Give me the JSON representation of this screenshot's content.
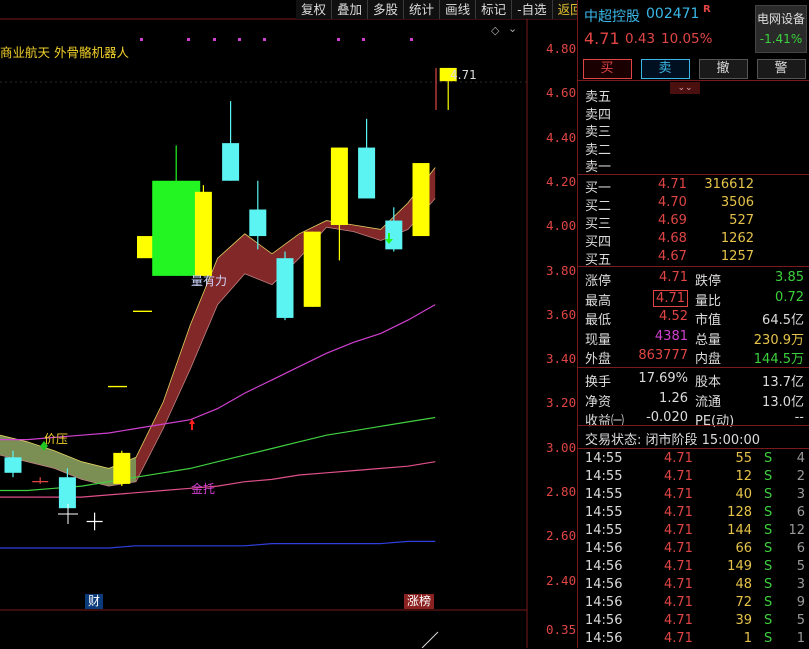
{
  "toolbar": [
    "复权",
    "叠加",
    "多股",
    "统计",
    "画线",
    "标记",
    "-自选",
    "返回"
  ],
  "indicator_title": "商业航天 外骨骼机器人",
  "price_axis": [
    "4.80",
    "4.60",
    "4.40",
    "4.20",
    "4.00",
    "3.80",
    "3.60",
    "3.40",
    "3.20",
    "3.00",
    "2.80",
    "2.60",
    "2.40"
  ],
  "sub_axis": "0.35",
  "last_price_marker": "4.71",
  "annotations": {
    "jia_ya": "价压",
    "jin_tuo": "金托",
    "liang_you_li": "量有力"
  },
  "tags": {
    "cai": "财",
    "zhang_bang": "涨榜"
  },
  "chart_data": {
    "type": "candlestick",
    "ylim": [
      2.3,
      4.88
    ],
    "candles": [
      {
        "o": 2.95,
        "h": 2.98,
        "l": 2.86,
        "c": 2.88,
        "color": "cyan"
      },
      {
        "o": 2.85,
        "h": 2.86,
        "l": 2.83,
        "c": 2.84,
        "color": "red-cross"
      },
      {
        "o": 2.86,
        "h": 2.9,
        "l": 2.72,
        "c": 2.72,
        "color": "cyan"
      },
      {
        "o": 2.68,
        "h": 2.7,
        "l": 2.62,
        "c": 2.66,
        "color": "white-cross"
      },
      {
        "o": 2.83,
        "h": 2.98,
        "l": 2.82,
        "c": 2.97,
        "color": "yellow"
      },
      {
        "o": 3.9,
        "h": 3.95,
        "l": 3.85,
        "c": 3.9,
        "color": "yellow-dash"
      },
      {
        "o": 4.2,
        "h": 4.36,
        "l": 3.77,
        "c": 3.77,
        "color": "green"
      },
      {
        "o": 3.77,
        "h": 4.18,
        "l": 3.77,
        "c": 4.15,
        "color": "yellow"
      },
      {
        "o": 4.2,
        "h": 4.56,
        "l": 4.2,
        "c": 4.37,
        "color": "cyan"
      },
      {
        "o": 4.07,
        "h": 4.2,
        "l": 3.89,
        "c": 3.95,
        "color": "cyan"
      },
      {
        "o": 3.85,
        "h": 3.88,
        "l": 3.57,
        "c": 3.58,
        "color": "cyan"
      },
      {
        "o": 3.63,
        "h": 3.97,
        "l": 3.63,
        "c": 3.97,
        "color": "yellow"
      },
      {
        "o": 4.0,
        "h": 4.35,
        "l": 3.84,
        "c": 4.35,
        "color": "yellow"
      },
      {
        "o": 4.35,
        "h": 4.48,
        "l": 4.12,
        "c": 4.12,
        "color": "cyan"
      },
      {
        "o": 4.02,
        "h": 4.08,
        "l": 3.88,
        "c": 3.89,
        "color": "cyan"
      },
      {
        "o": 3.95,
        "h": 4.28,
        "l": 3.95,
        "c": 4.28,
        "color": "yellow"
      },
      {
        "o": 4.65,
        "h": 4.71,
        "l": 4.52,
        "c": 4.71,
        "color": "yellow"
      }
    ],
    "ma_magenta": [
      3.03,
      3.03,
      3.04,
      3.05,
      3.06,
      3.08,
      3.1,
      3.12,
      3.17,
      3.24,
      3.3,
      3.36,
      3.42,
      3.47,
      3.51,
      3.57,
      3.64
    ],
    "ma_green": [
      2.8,
      2.8,
      2.81,
      2.82,
      2.84,
      2.86,
      2.88,
      2.9,
      2.93,
      2.96,
      2.99,
      3.02,
      3.05,
      3.07,
      3.09,
      3.11,
      3.13
    ],
    "ma_pink": [
      2.77,
      2.77,
      2.77,
      2.77,
      2.78,
      2.79,
      2.8,
      2.81,
      2.82,
      2.84,
      2.85,
      2.87,
      2.88,
      2.89,
      2.9,
      2.91,
      2.93
    ],
    "ma_blue": [
      2.54,
      2.54,
      2.54,
      2.54,
      2.54,
      2.55,
      2.55,
      2.55,
      2.55,
      2.55,
      2.56,
      2.56,
      2.56,
      2.56,
      2.56,
      2.57,
      2.57
    ],
    "band_upper": [
      3.05,
      3.02,
      2.98,
      2.93,
      2.9,
      2.95,
      3.2,
      3.55,
      3.85,
      3.96,
      3.87,
      3.96,
      4.02,
      4.0,
      3.98,
      4.1,
      4.26
    ],
    "band_lower": [
      2.96,
      2.93,
      2.9,
      2.85,
      2.82,
      2.84,
      3.08,
      3.35,
      3.64,
      3.78,
      3.73,
      3.85,
      3.99,
      3.97,
      3.93,
      3.98,
      4.12
    ]
  },
  "quote": {
    "name": "中超控股",
    "code": "002471",
    "badge": "R",
    "price": "4.71",
    "change": "0.43",
    "change_pct": "10.05%",
    "sector_name": "电网设备",
    "sector_change": "-1.41%"
  },
  "trade_buttons": [
    "买",
    "卖",
    "撤",
    "警"
  ],
  "asks": [
    "卖五",
    "卖四",
    "卖三",
    "卖二",
    "卖一"
  ],
  "bids": [
    {
      "label": "买一",
      "price": "4.71",
      "vol": "316612"
    },
    {
      "label": "买二",
      "price": "4.70",
      "vol": "3506"
    },
    {
      "label": "买三",
      "price": "4.69",
      "vol": "527"
    },
    {
      "label": "买四",
      "price": "4.68",
      "vol": "1262"
    },
    {
      "label": "买五",
      "price": "4.67",
      "vol": "1257"
    }
  ],
  "stats": [
    {
      "l1": "涨停",
      "v1": "4.71",
      "c1": "#e04545",
      "l2": "跌停",
      "v2": "3.85",
      "c2": "#3cd13c"
    },
    {
      "l1": "最高",
      "v1": "4.71",
      "c1": "#e04545",
      "boxed": true,
      "l2": "量比",
      "v2": "0.72",
      "c2": "#3cd13c"
    },
    {
      "l1": "最低",
      "v1": "4.52",
      "c1": "#e04545",
      "l2": "市值",
      "v2": "64.5亿",
      "c2": "#dcdcdc"
    },
    {
      "l1": "现量",
      "v1": "4381",
      "c1": "#d040d0",
      "l2": "总量",
      "v2": "230.9万",
      "c2": "#e6c34a"
    },
    {
      "l1": "外盘",
      "v1": "863777",
      "c1": "#e04545",
      "l2": "内盘",
      "v2": "144.5万",
      "c2": "#3cd13c"
    }
  ],
  "stats2": [
    {
      "l1": "换手",
      "v1": "17.69%",
      "c1": "#dcdcdc",
      "l2": "股本",
      "v2": "13.7亿",
      "c2": "#dcdcdc"
    },
    {
      "l1": "净资",
      "v1": "1.26",
      "c1": "#dcdcdc",
      "l2": "流通",
      "v2": "13.0亿",
      "c2": "#dcdcdc"
    },
    {
      "l1": "收益㈠",
      "v1": "-0.020",
      "c1": "#dcdcdc",
      "l2": "PE(动)",
      "v2": "--",
      "c2": "#dcdcdc"
    }
  ],
  "status": "交易状态: 闭市阶段 15:00:00",
  "ticks": [
    {
      "t": "14:55",
      "p": "4.71",
      "v": "55",
      "s": "S",
      "n": "4"
    },
    {
      "t": "14:55",
      "p": "4.71",
      "v": "12",
      "s": "S",
      "n": "2"
    },
    {
      "t": "14:55",
      "p": "4.71",
      "v": "40",
      "s": "S",
      "n": "3"
    },
    {
      "t": "14:55",
      "p": "4.71",
      "v": "128",
      "s": "S",
      "n": "6"
    },
    {
      "t": "14:55",
      "p": "4.71",
      "v": "144",
      "s": "S",
      "n": "12"
    },
    {
      "t": "14:56",
      "p": "4.71",
      "v": "66",
      "s": "S",
      "n": "6"
    },
    {
      "t": "14:56",
      "p": "4.71",
      "v": "149",
      "s": "S",
      "n": "5"
    },
    {
      "t": "14:56",
      "p": "4.71",
      "v": "48",
      "s": "S",
      "n": "3"
    },
    {
      "t": "14:56",
      "p": "4.71",
      "v": "72",
      "s": "S",
      "n": "9"
    },
    {
      "t": "14:56",
      "p": "4.71",
      "v": "39",
      "s": "S",
      "n": "5"
    },
    {
      "t": "14:56",
      "p": "4.71",
      "v": "1",
      "s": "S",
      "n": "1"
    }
  ]
}
